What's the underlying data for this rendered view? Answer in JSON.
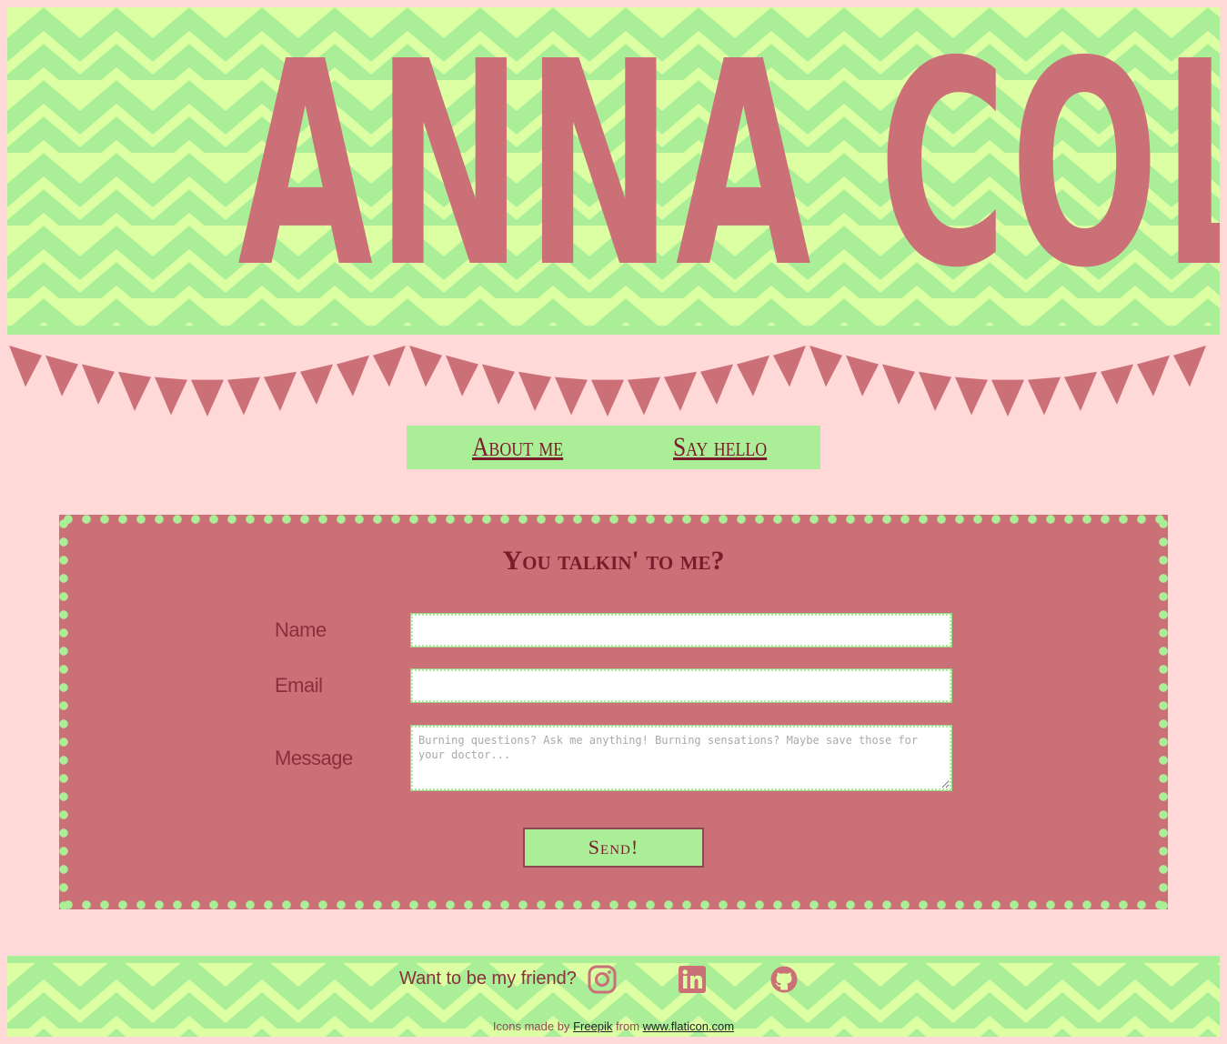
{
  "header": {
    "title": "ANNA COLE"
  },
  "nav": {
    "items": [
      {
        "label": "About me"
      },
      {
        "label": "Say hello"
      }
    ]
  },
  "contact_form": {
    "title": "You talkin' to me?",
    "fields": {
      "name": {
        "label": "Name",
        "value": "",
        "placeholder": ""
      },
      "email": {
        "label": "Email",
        "value": "",
        "placeholder": ""
      },
      "message": {
        "label": "Message",
        "value": "",
        "placeholder": "Burning questions? Ask me anything! Burning sensations? Maybe save those for your doctor..."
      }
    },
    "submit_label": "Send!"
  },
  "footer": {
    "friend_text": "Want to be my friend?",
    "social_icons": [
      "instagram-icon",
      "linkedin-icon",
      "github-icon"
    ],
    "credits": {
      "prefix": "Icons made by",
      "author": "Freepik",
      "middle": "from",
      "site": "www.flaticon.com"
    }
  },
  "colors": {
    "background": "#ffd8d8",
    "accent_green": "#aaee98",
    "light_green": "#ddffa3",
    "rose": "#cc7077",
    "dark_red": "#7a1c2a"
  }
}
